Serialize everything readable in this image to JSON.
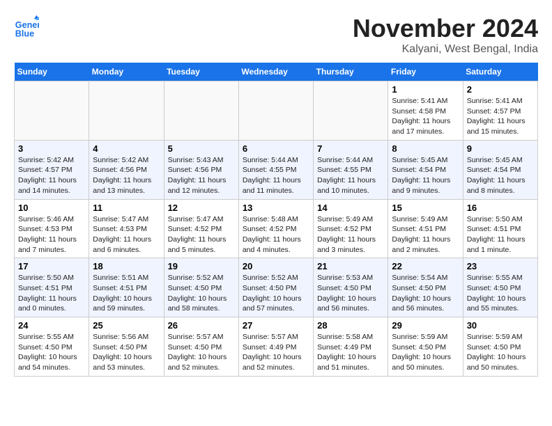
{
  "header": {
    "logo_line1": "General",
    "logo_line2": "Blue",
    "month": "November 2024",
    "location": "Kalyani, West Bengal, India"
  },
  "weekdays": [
    "Sunday",
    "Monday",
    "Tuesday",
    "Wednesday",
    "Thursday",
    "Friday",
    "Saturday"
  ],
  "weeks": [
    [
      {
        "day": "",
        "info": ""
      },
      {
        "day": "",
        "info": ""
      },
      {
        "day": "",
        "info": ""
      },
      {
        "day": "",
        "info": ""
      },
      {
        "day": "",
        "info": ""
      },
      {
        "day": "1",
        "info": "Sunrise: 5:41 AM\nSunset: 4:58 PM\nDaylight: 11 hours and 17 minutes."
      },
      {
        "day": "2",
        "info": "Sunrise: 5:41 AM\nSunset: 4:57 PM\nDaylight: 11 hours and 15 minutes."
      }
    ],
    [
      {
        "day": "3",
        "info": "Sunrise: 5:42 AM\nSunset: 4:57 PM\nDaylight: 11 hours and 14 minutes."
      },
      {
        "day": "4",
        "info": "Sunrise: 5:42 AM\nSunset: 4:56 PM\nDaylight: 11 hours and 13 minutes."
      },
      {
        "day": "5",
        "info": "Sunrise: 5:43 AM\nSunset: 4:56 PM\nDaylight: 11 hours and 12 minutes."
      },
      {
        "day": "6",
        "info": "Sunrise: 5:44 AM\nSunset: 4:55 PM\nDaylight: 11 hours and 11 minutes."
      },
      {
        "day": "7",
        "info": "Sunrise: 5:44 AM\nSunset: 4:55 PM\nDaylight: 11 hours and 10 minutes."
      },
      {
        "day": "8",
        "info": "Sunrise: 5:45 AM\nSunset: 4:54 PM\nDaylight: 11 hours and 9 minutes."
      },
      {
        "day": "9",
        "info": "Sunrise: 5:45 AM\nSunset: 4:54 PM\nDaylight: 11 hours and 8 minutes."
      }
    ],
    [
      {
        "day": "10",
        "info": "Sunrise: 5:46 AM\nSunset: 4:53 PM\nDaylight: 11 hours and 7 minutes."
      },
      {
        "day": "11",
        "info": "Sunrise: 5:47 AM\nSunset: 4:53 PM\nDaylight: 11 hours and 6 minutes."
      },
      {
        "day": "12",
        "info": "Sunrise: 5:47 AM\nSunset: 4:52 PM\nDaylight: 11 hours and 5 minutes."
      },
      {
        "day": "13",
        "info": "Sunrise: 5:48 AM\nSunset: 4:52 PM\nDaylight: 11 hours and 4 minutes."
      },
      {
        "day": "14",
        "info": "Sunrise: 5:49 AM\nSunset: 4:52 PM\nDaylight: 11 hours and 3 minutes."
      },
      {
        "day": "15",
        "info": "Sunrise: 5:49 AM\nSunset: 4:51 PM\nDaylight: 11 hours and 2 minutes."
      },
      {
        "day": "16",
        "info": "Sunrise: 5:50 AM\nSunset: 4:51 PM\nDaylight: 11 hours and 1 minute."
      }
    ],
    [
      {
        "day": "17",
        "info": "Sunrise: 5:50 AM\nSunset: 4:51 PM\nDaylight: 11 hours and 0 minutes."
      },
      {
        "day": "18",
        "info": "Sunrise: 5:51 AM\nSunset: 4:51 PM\nDaylight: 10 hours and 59 minutes."
      },
      {
        "day": "19",
        "info": "Sunrise: 5:52 AM\nSunset: 4:50 PM\nDaylight: 10 hours and 58 minutes."
      },
      {
        "day": "20",
        "info": "Sunrise: 5:52 AM\nSunset: 4:50 PM\nDaylight: 10 hours and 57 minutes."
      },
      {
        "day": "21",
        "info": "Sunrise: 5:53 AM\nSunset: 4:50 PM\nDaylight: 10 hours and 56 minutes."
      },
      {
        "day": "22",
        "info": "Sunrise: 5:54 AM\nSunset: 4:50 PM\nDaylight: 10 hours and 56 minutes."
      },
      {
        "day": "23",
        "info": "Sunrise: 5:55 AM\nSunset: 4:50 PM\nDaylight: 10 hours and 55 minutes."
      }
    ],
    [
      {
        "day": "24",
        "info": "Sunrise: 5:55 AM\nSunset: 4:50 PM\nDaylight: 10 hours and 54 minutes."
      },
      {
        "day": "25",
        "info": "Sunrise: 5:56 AM\nSunset: 4:50 PM\nDaylight: 10 hours and 53 minutes."
      },
      {
        "day": "26",
        "info": "Sunrise: 5:57 AM\nSunset: 4:50 PM\nDaylight: 10 hours and 52 minutes."
      },
      {
        "day": "27",
        "info": "Sunrise: 5:57 AM\nSunset: 4:49 PM\nDaylight: 10 hours and 52 minutes."
      },
      {
        "day": "28",
        "info": "Sunrise: 5:58 AM\nSunset: 4:49 PM\nDaylight: 10 hours and 51 minutes."
      },
      {
        "day": "29",
        "info": "Sunrise: 5:59 AM\nSunset: 4:50 PM\nDaylight: 10 hours and 50 minutes."
      },
      {
        "day": "30",
        "info": "Sunrise: 5:59 AM\nSunset: 4:50 PM\nDaylight: 10 hours and 50 minutes."
      }
    ]
  ]
}
